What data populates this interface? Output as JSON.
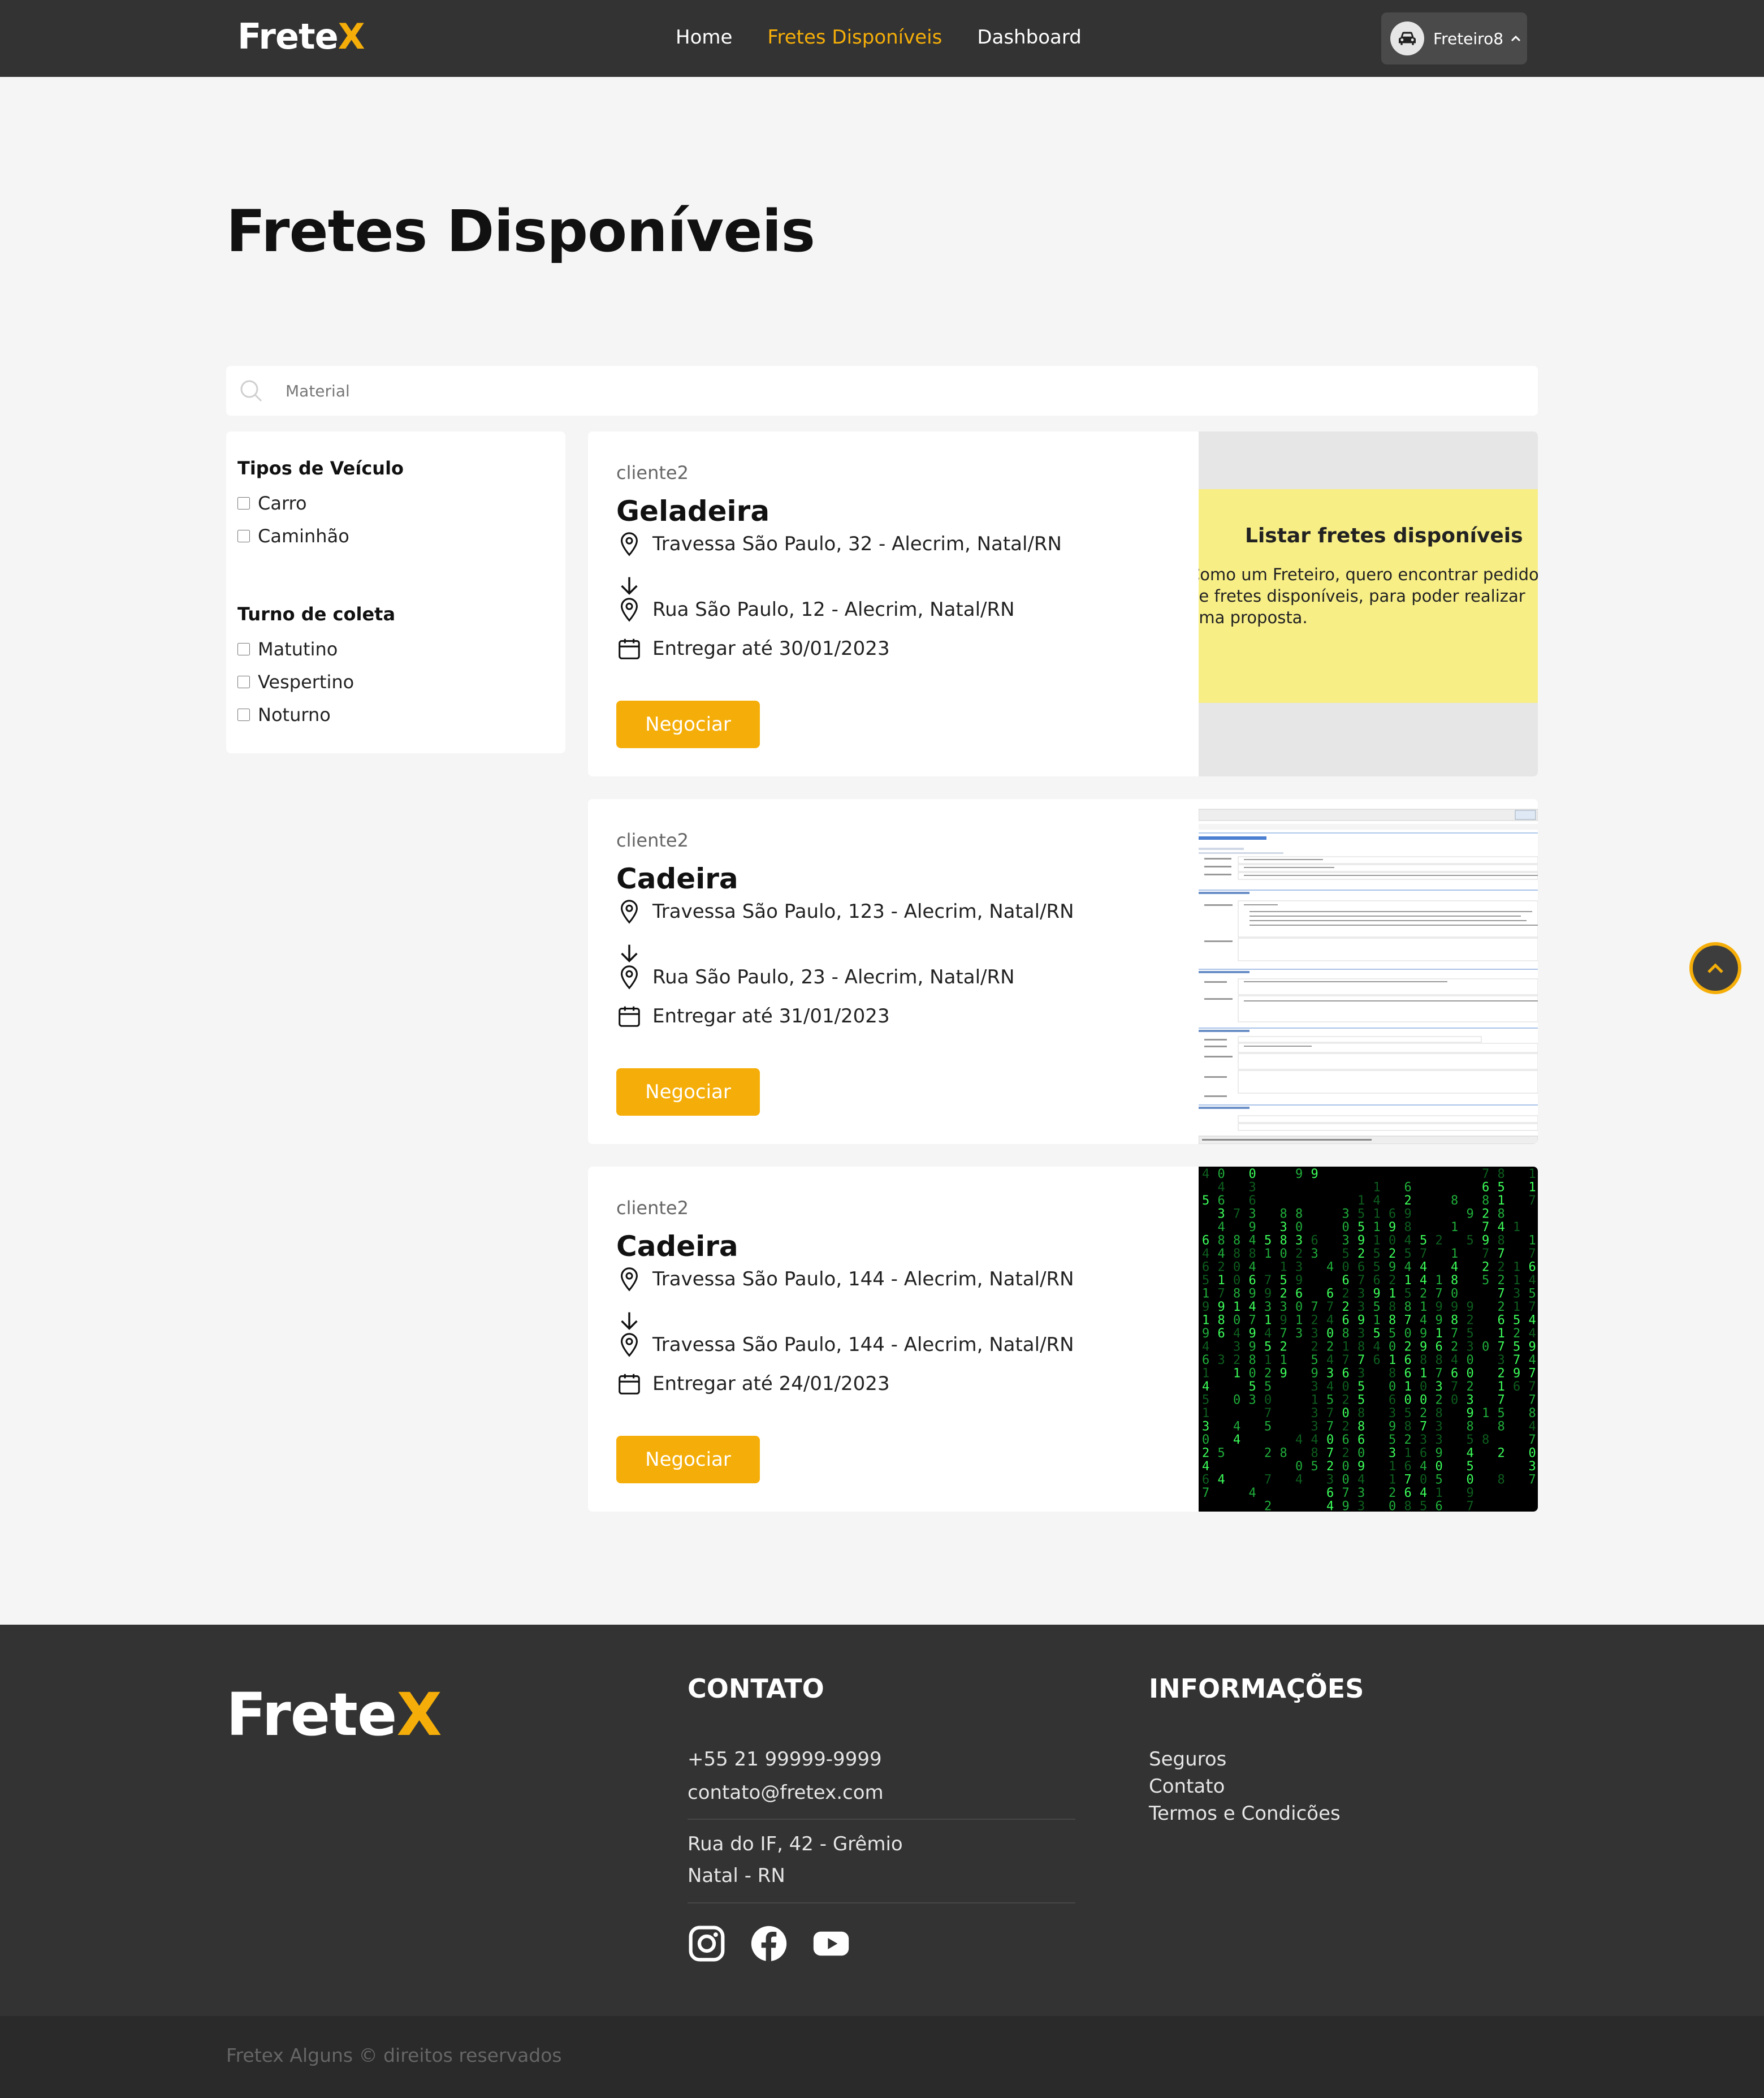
{
  "navbar": {
    "logo_main": "Frete",
    "logo_accent": "X",
    "links": [
      {
        "label": "Home"
      },
      {
        "label": "Fretes Disponíveis"
      },
      {
        "label": "Dashboard"
      }
    ],
    "user": {
      "name": "Freteiro8"
    }
  },
  "page": {
    "title": "Fretes Disponíveis"
  },
  "search": {
    "placeholder": "Material",
    "value": ""
  },
  "filters": {
    "vehicle_title": "Tipos de Veículo",
    "vehicle_options": [
      "Carro",
      "Caminhão"
    ],
    "shift_title": "Turno de coleta",
    "shift_options": [
      "Matutino",
      "Vespertino",
      "Noturno"
    ]
  },
  "cards": [
    {
      "client": "cliente2",
      "title": "Geladeira",
      "origin": "Travessa São Paulo, 32 - Alecrim, Natal/RN",
      "destination": "Rua São Paulo, 12 - Alecrim, Natal/RN",
      "deadline": "Entregar até 30/01/2023",
      "button": "Negociar",
      "image_title": "Listar fretes disponíveis",
      "image_text": "Como um Freteiro, quero encontrar pedidos de fretes disponíveis, para poder realizar uma proposta."
    },
    {
      "client": "cliente2",
      "title": "Cadeira",
      "origin": "Travessa São Paulo, 123 - Alecrim, Natal/RN",
      "destination": "Rua São Paulo, 23 - Alecrim, Natal/RN",
      "deadline": "Entregar até 31/01/2023",
      "button": "Negociar"
    },
    {
      "client": "cliente2",
      "title": "Cadeira",
      "origin": "Travessa São Paulo, 144 - Alecrim, Natal/RN",
      "destination": "Travessa São Paulo, 144 - Alecrim, Natal/RN",
      "deadline": "Entregar até 24/01/2023",
      "button": "Negociar"
    }
  ],
  "footer": {
    "logo_main": "Frete",
    "logo_accent": "X",
    "contact_title": "CONTATO",
    "phone": "+55 21 99999-9999",
    "email": "contato@fretex.com",
    "address_line1": "Rua do IF, 42 - Grêmio",
    "address_line2": "Natal - RN",
    "info_title": "INFORMAÇÕES",
    "info_links": [
      "Seguros",
      "Contato",
      "Termos e Condicões"
    ],
    "copyright": "Fretex Alguns © direitos reservados"
  },
  "colors": {
    "accent": "#f5ae09",
    "dark": "#333333",
    "background": "#f5f5f5"
  }
}
